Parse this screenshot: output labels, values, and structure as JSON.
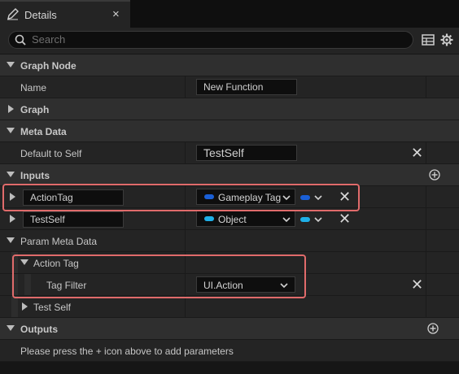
{
  "tab": {
    "title": "Details",
    "close": "×",
    "icon": "pencil-icon"
  },
  "search": {
    "placeholder": "Search"
  },
  "toolbar": {
    "icons": [
      "table-icon",
      "gear-icon"
    ]
  },
  "sections": {
    "graph_node": {
      "label": "Graph Node",
      "name_label": "Name",
      "name_value": "New Function"
    },
    "graph": {
      "label": "Graph"
    },
    "meta_data": {
      "label": "Meta Data",
      "default_to_self_label": "Default to Self",
      "default_to_self_value": "TestSelf"
    },
    "inputs": {
      "label": "Inputs",
      "params": [
        {
          "name": "ActionTag",
          "type": "Gameplay Tag",
          "type_color": "#1a5fd6"
        },
        {
          "name": "TestSelf",
          "type": "Object",
          "type_color": "#1fb0e8"
        }
      ]
    },
    "param_meta_data": {
      "label": "Param Meta Data",
      "action_tag": {
        "label": "Action Tag",
        "tag_filter_label": "Tag Filter",
        "tag_filter_value": "UI.Action"
      },
      "test_self": {
        "label": "Test Self"
      }
    },
    "outputs": {
      "label": "Outputs",
      "hint": "Please press the + icon above to add parameters"
    }
  },
  "colors": {
    "highlight": "#e06b6b",
    "background": "#242424",
    "category": "#2f2f2f"
  }
}
